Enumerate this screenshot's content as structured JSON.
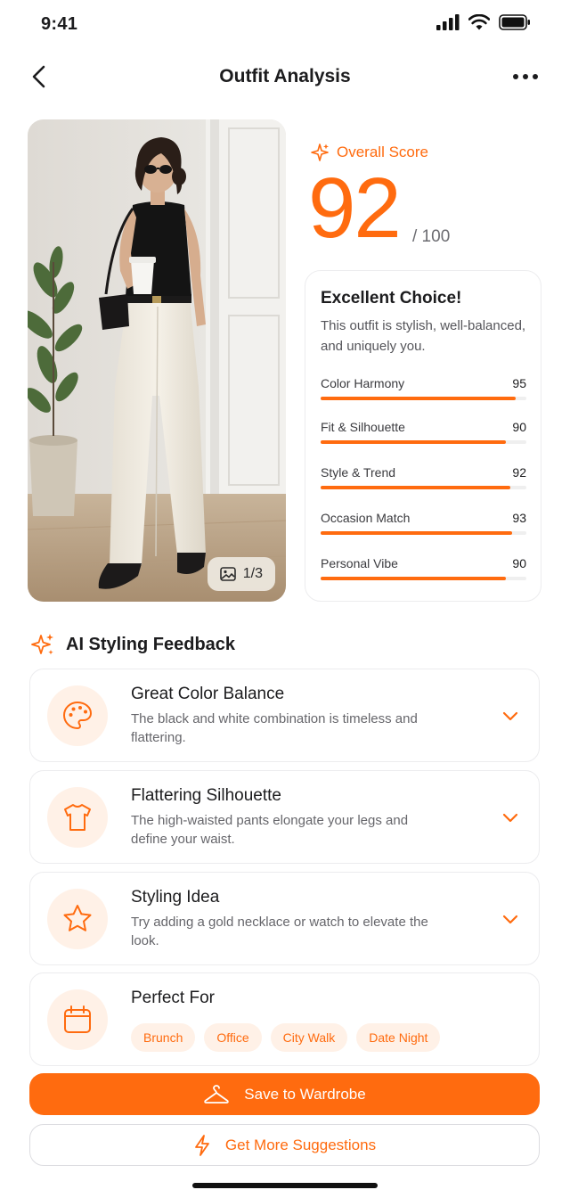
{
  "status_bar": {
    "time": "9:41"
  },
  "nav": {
    "title": "Outfit Analysis"
  },
  "photo": {
    "counter": "1/3"
  },
  "score": {
    "label": "Overall Score",
    "value": "92",
    "max": "/ 100",
    "headline": "Excellent Choice!",
    "description": "This outfit is stylish, well-balanced, and uniquely you.",
    "metrics": [
      {
        "name": "Color Harmony",
        "value": 95
      },
      {
        "name": "Fit & Silhouette",
        "value": 90
      },
      {
        "name": "Style & Trend",
        "value": 92
      },
      {
        "name": "Occasion Match",
        "value": 93
      },
      {
        "name": "Personal Vibe",
        "value": 90
      }
    ]
  },
  "feedback": {
    "title": "AI Styling Feedback",
    "items": [
      {
        "title": "Great Color Balance",
        "desc": "The black and white combination is timeless and flattering.",
        "icon": "palette-icon"
      },
      {
        "title": "Flattering Silhouette",
        "desc": "The high-waisted pants elongate your legs and define your waist.",
        "icon": "shirt-icon"
      },
      {
        "title": "Styling Idea",
        "desc": "Try adding a gold necklace or watch to elevate the look.",
        "icon": "star-icon"
      }
    ],
    "perfect_for": {
      "title": "Perfect For",
      "icon": "calendar-icon",
      "tags": [
        "Brunch",
        "Office",
        "City Walk",
        "Date Night"
      ]
    }
  },
  "actions": {
    "save_label": "Save to Wardrobe",
    "suggest_label": "Get More Suggestions"
  },
  "colors": {
    "accent": "#ff6b0f",
    "accent_soft": "#fff1e7"
  }
}
